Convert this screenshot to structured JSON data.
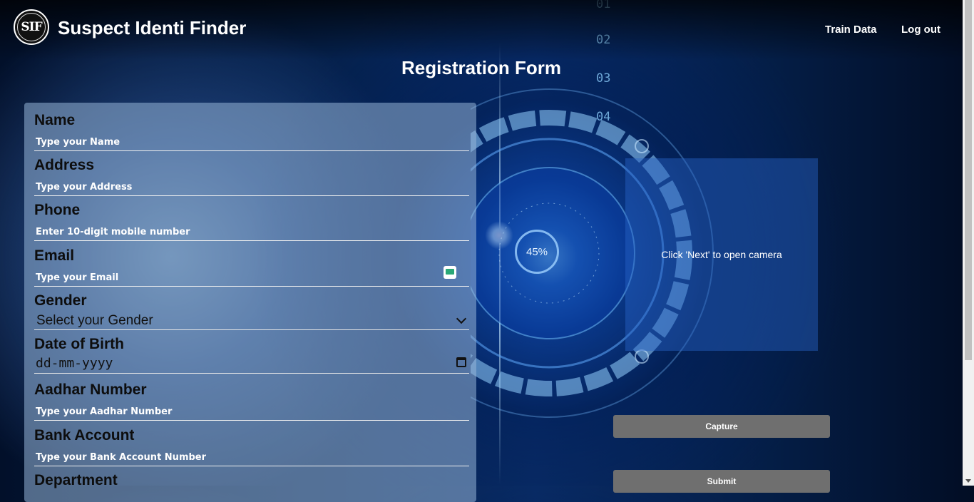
{
  "header": {
    "logo_text": "SIF",
    "brand": "Suspect Identi Finder",
    "nav": {
      "train": "Train Data",
      "logout": "Log out"
    }
  },
  "page_title": "Registration Form",
  "form": {
    "name": {
      "label": "Name",
      "placeholder": "Type your Name"
    },
    "address": {
      "label": "Address",
      "placeholder": "Type your Address"
    },
    "phone": {
      "label": "Phone",
      "placeholder": "Enter 10-digit mobile number"
    },
    "email": {
      "label": "Email",
      "placeholder": "Type your Email"
    },
    "gender": {
      "label": "Gender",
      "selected": "Select your Gender"
    },
    "dob": {
      "label": "Date of Birth",
      "placeholder": "dd-mm-yyyy"
    },
    "aadhar": {
      "label": "Aadhar Number",
      "placeholder": "Type your Aadhar Number"
    },
    "bank": {
      "label": "Bank Account",
      "placeholder": "Type your Bank Account Number"
    },
    "department": {
      "label": "Department"
    }
  },
  "camera": {
    "message": "Click 'Next' to open camera",
    "capture_label": "Capture",
    "submit_label": "Submit"
  },
  "decoration": {
    "percent": "45%",
    "digits": [
      "01",
      "02",
      "03",
      "04"
    ]
  }
}
